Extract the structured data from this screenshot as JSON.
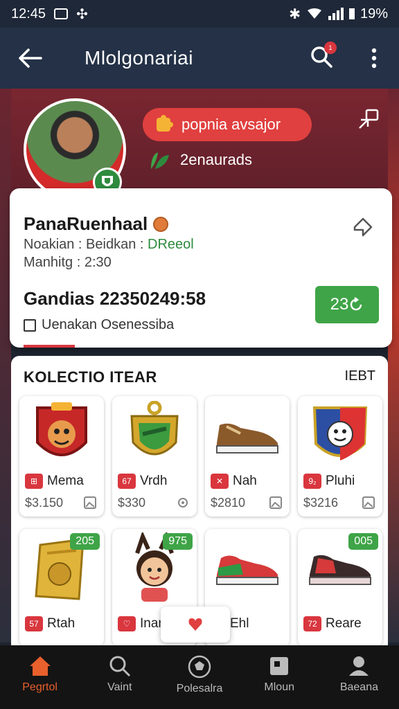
{
  "status_bar": {
    "time": "12:45",
    "battery": "19%"
  },
  "app_bar": {
    "title": "Mlolgonariai",
    "notification_count": "1"
  },
  "hero": {
    "badge_label": "popnia avsajor",
    "sub_label": "2enaurads"
  },
  "profile": {
    "name": "PanaRuenhaal",
    "line1_prefix": "Noakian : Beidkan : ",
    "line1_green": "DReeol",
    "line2": "Manhitg : 2:30",
    "balance": "Gandias 22350249:58",
    "checkbox_label": "Uenakan Osenessiba",
    "action_value": "23"
  },
  "collection": {
    "heading": "KOLECTIO ITEAR",
    "heading_right": "IEBT",
    "items": [
      {
        "name": "Mema",
        "tag": "⊞",
        "price": "$3.150"
      },
      {
        "name": "Vrdh",
        "tag": "67",
        "price": "$330"
      },
      {
        "name": "Nah",
        "tag": "✕",
        "price": "$2810"
      },
      {
        "name": "Pluhi",
        "tag": "9₂",
        "price": "$3216"
      },
      {
        "name": "Rtah",
        "tag": "57",
        "badge": "205"
      },
      {
        "name": "Inar",
        "tag": "♡",
        "badge": "975"
      },
      {
        "name": "Ehl",
        "tag": ""
      },
      {
        "name": "Reare",
        "tag": "72",
        "badge": "005"
      }
    ]
  },
  "nav": [
    {
      "label": "Pegrtol",
      "icon": "home-icon"
    },
    {
      "label": "Vaint",
      "icon": "search-icon"
    },
    {
      "label": "Polesalra",
      "icon": "ball-icon"
    },
    {
      "label": "Mloun",
      "icon": "cards-icon"
    },
    {
      "label": "Baeana",
      "icon": "person-icon"
    }
  ],
  "colors": {
    "accent": "#e0403f",
    "green": "#3fa447",
    "nav_active": "#e8602c",
    "appbar": "#243146"
  }
}
